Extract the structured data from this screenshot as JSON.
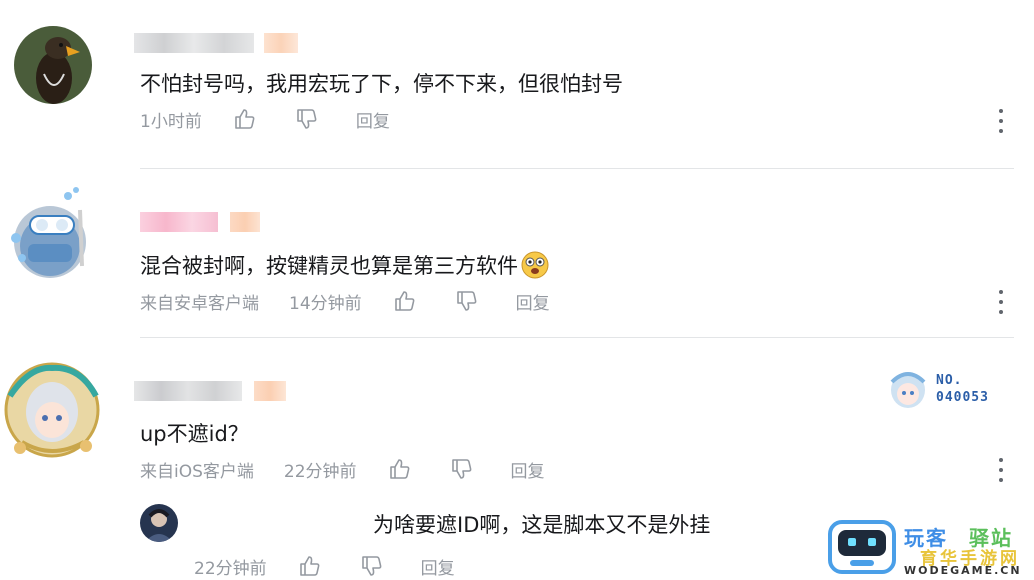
{
  "comments": [
    {
      "text": "不怕封号吗，我用宏玩了下，停不下来，但很怕封号",
      "time": "1小时前",
      "reply_label": "回复"
    },
    {
      "text": "混合被封啊，按键精灵也算是第三方软件",
      "source": "来自安卓客户端",
      "time": "14分钟前",
      "reply_label": "回复",
      "emoji": "scared-face-emoji"
    },
    {
      "text": "up不遮id？",
      "source": "来自iOS客户端",
      "time": "22分钟前",
      "reply_label": "回复",
      "badge_label": "NO.",
      "badge_number": "040053"
    }
  ],
  "sub_reply": {
    "text": "为啥要遮ID啊，这是脚本又不是外挂",
    "time": "22分钟前",
    "reply_label": "回复"
  },
  "watermark": {
    "line1a": "玩客",
    "line1b": "驿站",
    "line2": "育华手游网",
    "line3": "WODEGAME.CN"
  },
  "colors": {
    "text": "#18191c",
    "meta": "#9499a0",
    "divider": "#e3e5e7",
    "username_blur_1": "#d9dadc",
    "username_blur_2": "#f7c9d9",
    "level_badge": "#fbd3b8"
  }
}
